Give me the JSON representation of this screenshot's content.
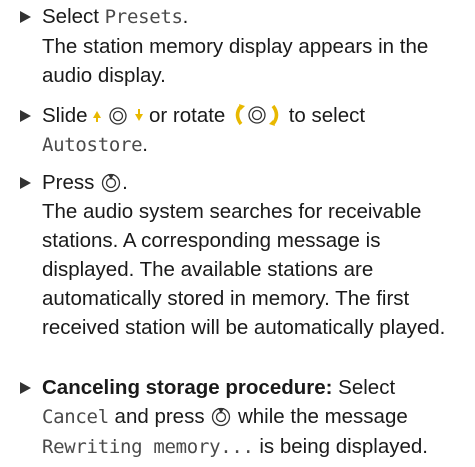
{
  "steps": [
    {
      "pre": "Select ",
      "code": "Presets",
      "post": ".",
      "result": "The station memory display appears in the audio display."
    },
    {
      "pre": "Slide ",
      "mid": " or rotate ",
      "mid2": " to select",
      "code": "Autostore",
      "post": "."
    },
    {
      "pre": "Press ",
      "post": ".",
      "result": "The audio system searches for receivable stations. A corresponding message is displayed. The available stations are automatically stored in memory. The first received station will be automatically played."
    },
    {
      "bold": "Canceling storage procedure:",
      "pre": " Select",
      "code1": "Cancel",
      "mid": " and press ",
      "mid2": " while the message",
      "code2": "Rewriting memory...",
      "post": " is being displayed."
    }
  ],
  "colors": {
    "text": "#1a1a1a",
    "code": "#4a4a4a",
    "bullet": "#333333",
    "arrow_accent": "#e8b800"
  },
  "icons": {
    "bullet": "triangle-bullet-icon",
    "slide": "slide-up-down-controller-icon",
    "rotate": "rotate-controller-icon",
    "press": "press-controller-icon"
  }
}
